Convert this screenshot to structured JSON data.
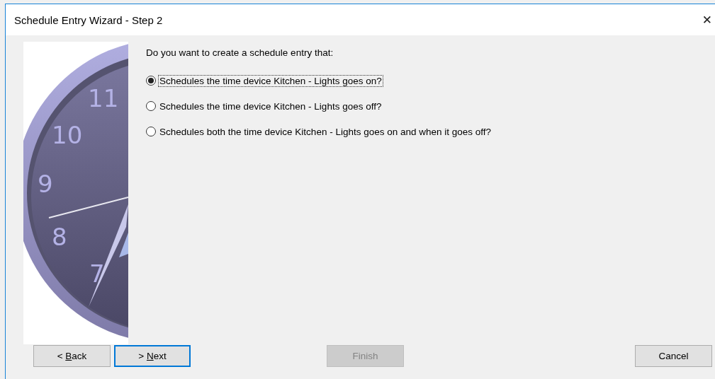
{
  "window": {
    "title": "Schedule Entry Wizard - Step 2",
    "close": "✕"
  },
  "clock": {
    "numerals": [
      "11",
      "10",
      "9",
      "8",
      "7"
    ]
  },
  "question": "Do you want to create a schedule entry that:",
  "options": [
    {
      "label": "Schedules the time device Kitchen - Lights goes on?",
      "selected": true,
      "focused": true
    },
    {
      "label": "Schedules the time device Kitchen - Lights goes off?",
      "selected": false,
      "focused": false
    },
    {
      "label": "Schedules both the time device Kitchen - Lights goes on and when it goes off?",
      "selected": false,
      "focused": false
    }
  ],
  "buttons": [
    {
      "prefix": "< ",
      "mnemonic": "B",
      "rest": "ack",
      "disabled": false,
      "focused": false
    },
    {
      "prefix": "> ",
      "mnemonic": "N",
      "rest": "ext",
      "disabled": false,
      "focused": true
    },
    {
      "prefix": "Finish",
      "disabled": true,
      "focused": false
    },
    {
      "prefix": "Cancel",
      "disabled": false,
      "focused": false
    }
  ]
}
